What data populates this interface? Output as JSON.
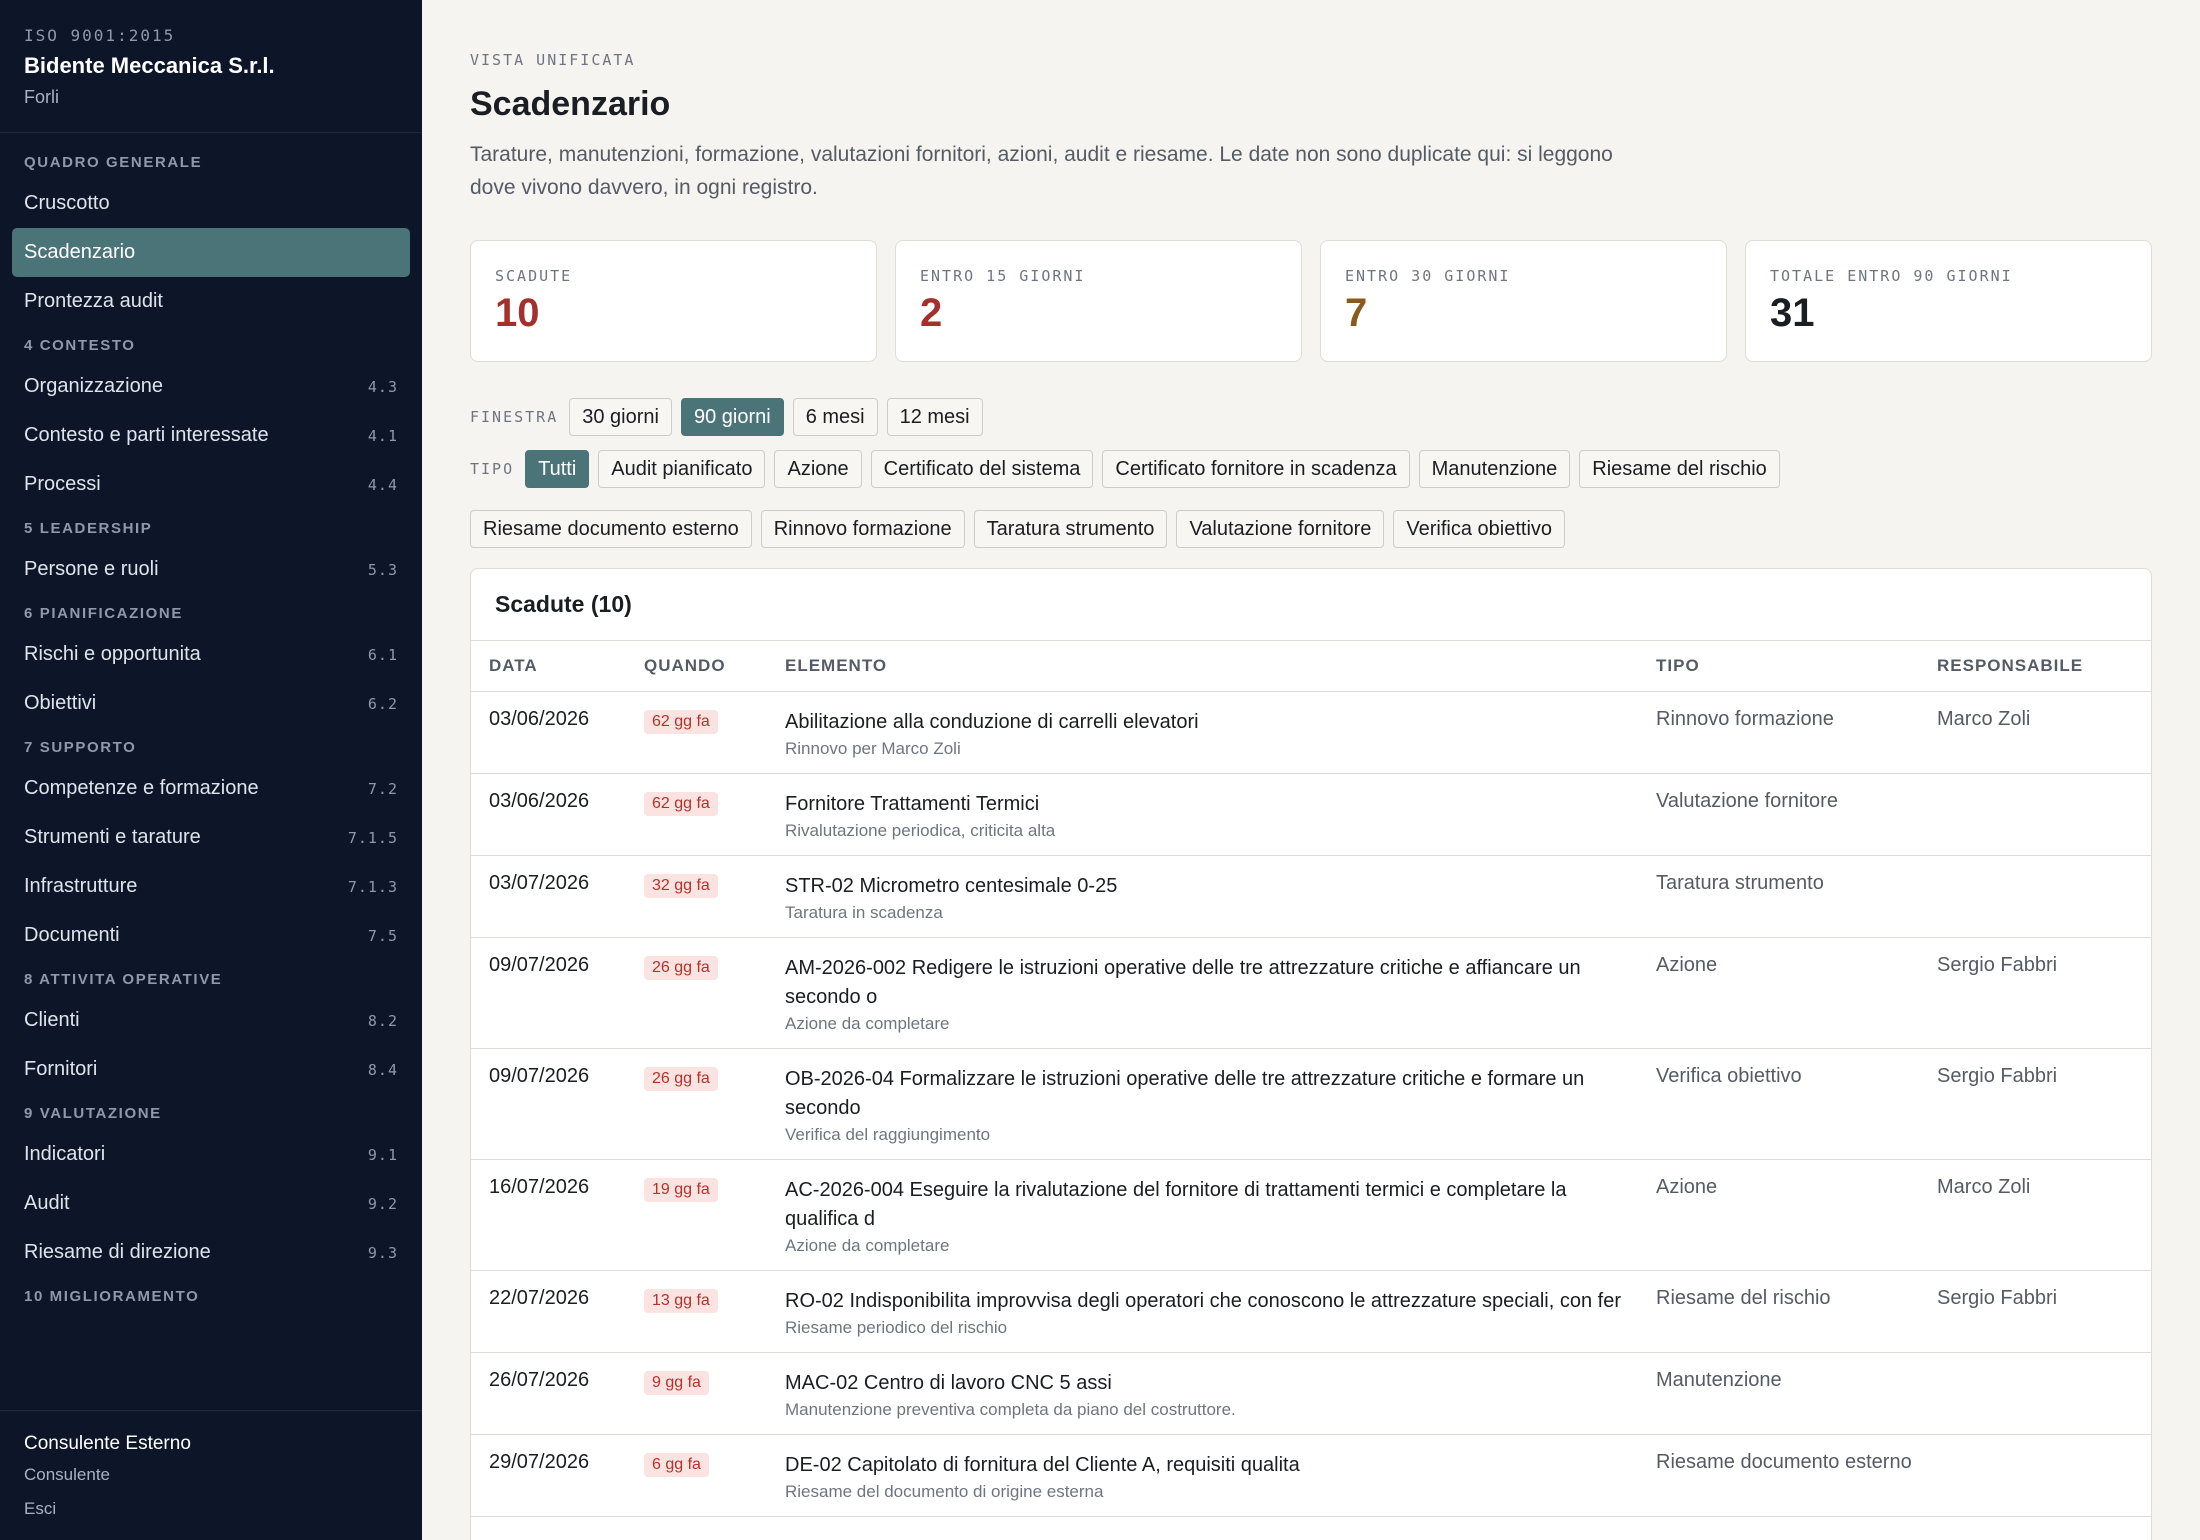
{
  "brand": {
    "iso": "ISO 9001:2015",
    "company": "Bidente Meccanica S.r.l.",
    "city": "Forli"
  },
  "sidebar": {
    "groups": [
      {
        "title": "QUADRO GENERALE",
        "items": [
          {
            "label": "Cruscotto",
            "clause": ""
          },
          {
            "label": "Scadenzario",
            "clause": "",
            "active": true
          },
          {
            "label": "Prontezza audit",
            "clause": ""
          }
        ]
      },
      {
        "title": "4 CONTESTO",
        "items": [
          {
            "label": "Organizzazione",
            "clause": "4.3"
          },
          {
            "label": "Contesto e parti interessate",
            "clause": "4.1"
          },
          {
            "label": "Processi",
            "clause": "4.4"
          }
        ]
      },
      {
        "title": "5 LEADERSHIP",
        "items": [
          {
            "label": "Persone e ruoli",
            "clause": "5.3"
          }
        ]
      },
      {
        "title": "6 PIANIFICAZIONE",
        "items": [
          {
            "label": "Rischi e opportunita",
            "clause": "6.1"
          },
          {
            "label": "Obiettivi",
            "clause": "6.2"
          }
        ]
      },
      {
        "title": "7 SUPPORTO",
        "items": [
          {
            "label": "Competenze e formazione",
            "clause": "7.2"
          },
          {
            "label": "Strumenti e tarature",
            "clause": "7.1.5"
          },
          {
            "label": "Infrastrutture",
            "clause": "7.1.3"
          },
          {
            "label": "Documenti",
            "clause": "7.5"
          }
        ]
      },
      {
        "title": "8 ATTIVITA OPERATIVE",
        "items": [
          {
            "label": "Clienti",
            "clause": "8.2"
          },
          {
            "label": "Fornitori",
            "clause": "8.4"
          }
        ]
      },
      {
        "title": "9 VALUTAZIONE",
        "items": [
          {
            "label": "Indicatori",
            "clause": "9.1"
          },
          {
            "label": "Audit",
            "clause": "9.2"
          },
          {
            "label": "Riesame di direzione",
            "clause": "9.3"
          }
        ]
      },
      {
        "title": "10 MIGLIORAMENTO",
        "items": []
      }
    ]
  },
  "user": {
    "name": "Consulente Esterno",
    "role": "Consulente",
    "logout": "Esci"
  },
  "header": {
    "eyebrow": "VISTA UNIFICATA",
    "title": "Scadenzario",
    "description": "Tarature, manutenzioni, formazione, valutazioni fornitori, azioni, audit e riesame. Le date non sono duplicate qui: si leggono dove vivono davvero, in ogni registro."
  },
  "stats": [
    {
      "label": "SCADUTE",
      "value": "10",
      "color": "#a3302a"
    },
    {
      "label": "ENTRO 15 GIORNI",
      "value": "2",
      "color": "#a3302a"
    },
    {
      "label": "ENTRO 30 GIORNI",
      "value": "7",
      "color": "#8a5a1c"
    },
    {
      "label": "TOTALE ENTRO 90 GIORNI",
      "value": "31",
      "color": "#1a1d22"
    }
  ],
  "filters": {
    "window_label": "FINESTRA",
    "window_options": [
      {
        "label": "30 giorni",
        "on": false
      },
      {
        "label": "90 giorni",
        "on": true
      },
      {
        "label": "6 mesi",
        "on": false
      },
      {
        "label": "12 mesi",
        "on": false
      }
    ],
    "type_label": "TIPO",
    "type_options": [
      {
        "label": "Tutti",
        "on": true
      },
      {
        "label": "Audit pianificato",
        "on": false
      },
      {
        "label": "Azione",
        "on": false
      },
      {
        "label": "Certificato del sistema",
        "on": false
      },
      {
        "label": "Certificato fornitore in scadenza",
        "on": false
      },
      {
        "label": "Manutenzione",
        "on": false
      },
      {
        "label": "Riesame del rischio",
        "on": false
      },
      {
        "label": "Riesame documento esterno",
        "on": false,
        "break_before": true
      },
      {
        "label": "Rinnovo formazione",
        "on": false
      },
      {
        "label": "Taratura strumento",
        "on": false
      },
      {
        "label": "Valutazione fornitore",
        "on": false
      },
      {
        "label": "Verifica obiettivo",
        "on": false
      }
    ]
  },
  "panel": {
    "title": "Scadute (10)",
    "columns": [
      "DATA",
      "QUANDO",
      "ELEMENTO",
      "TIPO",
      "RESPONSABILE"
    ],
    "rows": [
      {
        "date": "03/06/2026",
        "when": "62 gg fa",
        "title": "Abilitazione alla conduzione di carrelli elevatori",
        "sub": "Rinnovo per Marco Zoli",
        "type": "Rinnovo formazione",
        "owner": "Marco Zoli"
      },
      {
        "date": "03/06/2026",
        "when": "62 gg fa",
        "title": "Fornitore Trattamenti Termici",
        "sub": "Rivalutazione periodica, criticita alta",
        "type": "Valutazione fornitore",
        "owner": ""
      },
      {
        "date": "03/07/2026",
        "when": "32 gg fa",
        "title": "STR-02 Micrometro centesimale 0-25",
        "sub": "Taratura in scadenza",
        "type": "Taratura strumento",
        "owner": ""
      },
      {
        "date": "09/07/2026",
        "when": "26 gg fa",
        "title": "AM-2026-002 Redigere le istruzioni operative delle tre attrezzature critiche e affiancare un secondo o",
        "sub": "Azione da completare",
        "type": "Azione",
        "owner": "Sergio Fabbri"
      },
      {
        "date": "09/07/2026",
        "when": "26 gg fa",
        "title": "OB-2026-04 Formalizzare le istruzioni operative delle tre attrezzature critiche e formare un secondo",
        "sub": "Verifica del raggiungimento",
        "type": "Verifica obiettivo",
        "owner": "Sergio Fabbri"
      },
      {
        "date": "16/07/2026",
        "when": "19 gg fa",
        "title": "AC-2026-004 Eseguire la rivalutazione del fornitore di trattamenti termici e completare la qualifica d",
        "sub": "Azione da completare",
        "type": "Azione",
        "owner": "Marco Zoli"
      },
      {
        "date": "22/07/2026",
        "when": "13 gg fa",
        "title": "RO-02 Indisponibilita improvvisa degli operatori che conoscono le attrezzature speciali, con fer",
        "sub": "Riesame periodico del rischio",
        "type": "Riesame del rischio",
        "owner": "Sergio Fabbri"
      },
      {
        "date": "26/07/2026",
        "when": "9 gg fa",
        "title": "MAC-02 Centro di lavoro CNC 5 assi",
        "sub": "Manutenzione preventiva completa da piano del costruttore.",
        "type": "Manutenzione",
        "owner": ""
      },
      {
        "date": "29/07/2026",
        "when": "6 gg fa",
        "title": "DE-02 Capitolato di fornitura del Cliente A, requisiti qualita",
        "sub": "Riesame del documento di origine esterna",
        "type": "Riesame documento esterno",
        "owner": ""
      }
    ]
  }
}
